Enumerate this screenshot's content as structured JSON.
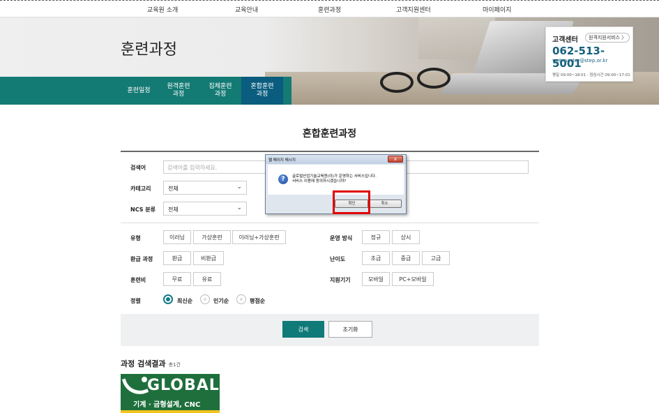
{
  "top_nav": [
    "교육원 소개",
    "교육안내",
    "훈련과정",
    "고객지원센터",
    "마이페이지"
  ],
  "page_title": "훈련과정",
  "sub_tabs": [
    {
      "label": "훈련일정"
    },
    {
      "label": "원격훈련\n과정"
    },
    {
      "label": "집체훈련\n과정"
    },
    {
      "label": "혼합훈련\n과정"
    }
  ],
  "help_center": {
    "title": "고객센터",
    "remote_button": "원격지원서비스 〉",
    "phone": "062-513-5001",
    "email": "webmaster@step.or.kr",
    "hours": "평일 09:00~18:01 · 점심시간 09:00~17:01"
  },
  "main_title": "혼합훈련과정",
  "search": {
    "keyword_label": "검색어",
    "keyword_placeholder": "검색어를 입력하세요.",
    "category_label": "카테고리",
    "category_value": "전체",
    "ncs_label": "NCS 분류",
    "ncs_value": "전체",
    "type_label": "유형",
    "type_options": [
      "이러닝",
      "가상훈련",
      "이러닝+가상훈련"
    ],
    "operation_label": "운영 방식",
    "operation_options": [
      "정규",
      "상시"
    ],
    "refund_label": "환급 과정",
    "refund_options": [
      "환급",
      "비환급"
    ],
    "difficulty_label": "난이도",
    "difficulty_options": [
      "초급",
      "중급",
      "고급"
    ],
    "fee_label": "훈련비",
    "fee_options": [
      "무료",
      "유료"
    ],
    "device_label": "지원기기",
    "device_options": [
      "모바일",
      "PC+모바일"
    ],
    "sort_label": "정렬",
    "sort_options": [
      "최신순",
      "인기순",
      "평점순"
    ],
    "search_button": "검색",
    "reset_button": "초기화"
  },
  "result": {
    "title": "과정 검색결과",
    "count": "총1건",
    "logo_text": "GLOBAL",
    "logo_sub": "기계 · 금형설계, CNC"
  },
  "dialog": {
    "title": "웹 페이지 메시지",
    "close": "x",
    "icon": "question-icon",
    "message_line1": "글로벌산업기술교육원(이)가 운영하는 서비스입니다.",
    "message_line2": "서비스 이용에 동의하시겠습니까?",
    "ok_button": "확인",
    "cancel_button": "취소"
  }
}
